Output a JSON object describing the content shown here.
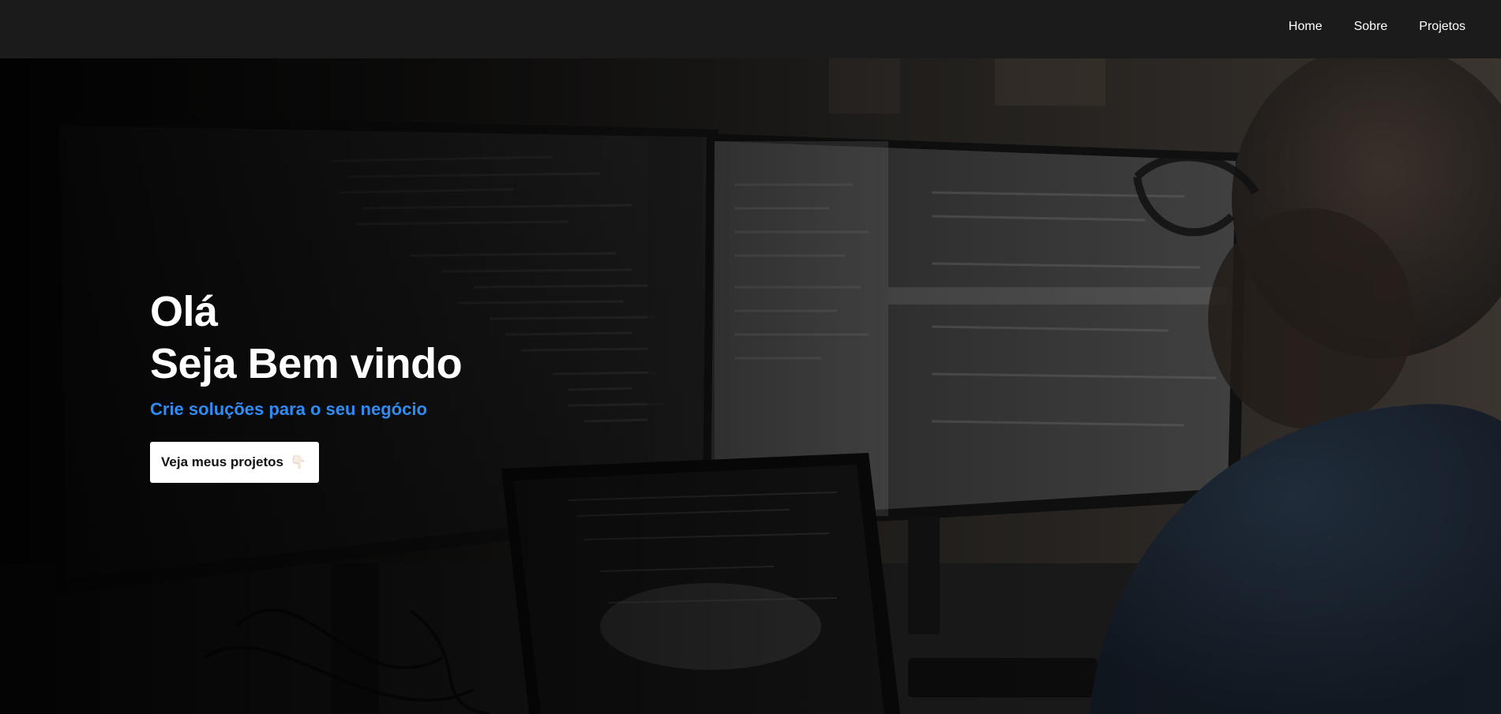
{
  "nav": {
    "items": [
      {
        "label": "Home"
      },
      {
        "label": "Sobre"
      },
      {
        "label": "Projetos"
      }
    ]
  },
  "hero": {
    "greeting": "Olá",
    "welcome": "Seja Bem vindo",
    "tagline": "Crie soluções para o seu negócio",
    "cta": {
      "label": "Veja meus projetos",
      "icon": "pointing-down-hand-icon",
      "icon_glyph": "👇🏻"
    },
    "background_image": "developer-at-monitors-coding-photo"
  },
  "colors": {
    "navbar": "#1b1b1c",
    "accent": "#2f8cf4",
    "button_bg": "#ffffff",
    "text": "#ffffff"
  }
}
